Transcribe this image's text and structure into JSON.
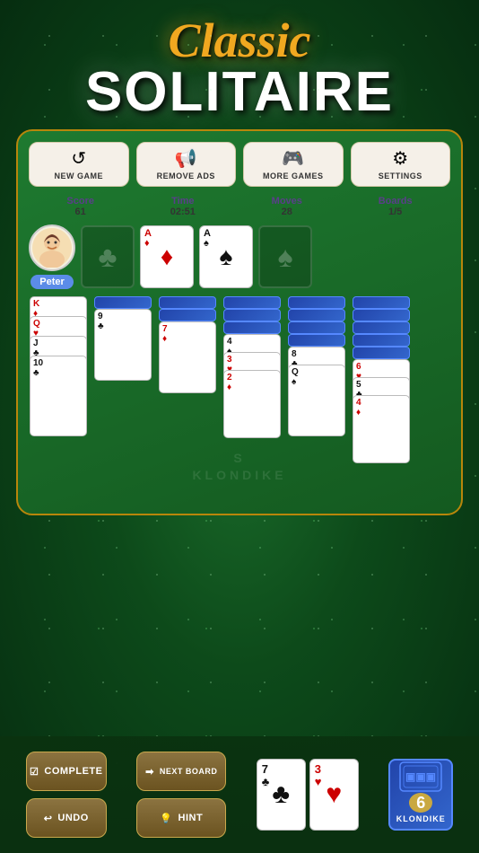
{
  "title": {
    "classic": "Classic",
    "solitaire": "SOLITAIRE"
  },
  "toolbar": {
    "new_game": "NEW GAME",
    "remove_ads": "REMOVE ADS",
    "more_games": "MORE GAMES",
    "settings": "SETTINGS"
  },
  "stats": {
    "score_label": "Score",
    "score_value": "61",
    "time_label": "Time",
    "time_value": "02:51",
    "moves_label": "Moves",
    "moves_value": "28",
    "boards_label": "Boards",
    "boards_value": "1/5"
  },
  "player": {
    "name": "Peter"
  },
  "bottom": {
    "complete": "COMPLETE",
    "next_board": "NEXT BOARD",
    "undo": "UNDO",
    "hint": "HINT",
    "stock_number": "6",
    "stock_label": "KLONDIKE"
  },
  "watermark": {
    "line1": "S",
    "line2": "KLONDIKE"
  }
}
